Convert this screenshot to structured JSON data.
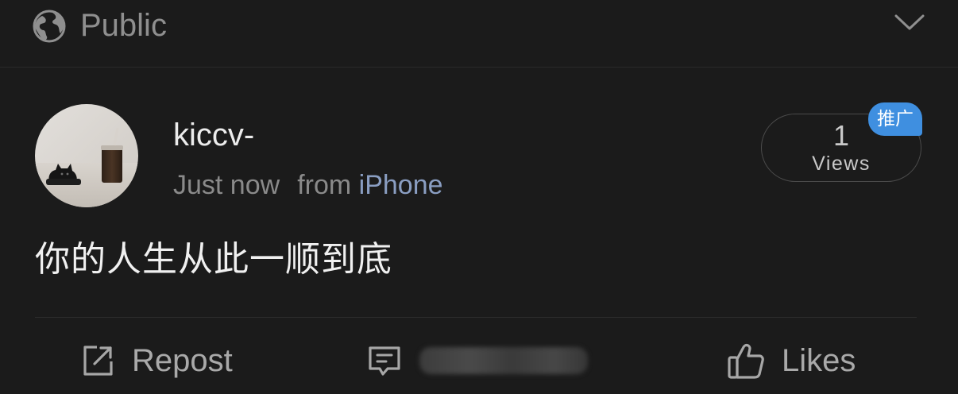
{
  "visibility": {
    "label": "Public",
    "icon": "globe-icon",
    "expand_icon": "chevron-down-icon"
  },
  "post": {
    "username": "kiccv-",
    "time": "Just now",
    "from_prefix": "from",
    "source": "iPhone",
    "text": "你的人生从此一顺到底",
    "views": {
      "count": "1",
      "label": "Views"
    },
    "promo_badge": "推广"
  },
  "actions": {
    "repost": {
      "label": "Repost",
      "icon": "repost-icon"
    },
    "comment": {
      "icon": "comment-icon"
    },
    "likes": {
      "label": "Likes",
      "icon": "thumbs-up-icon"
    }
  },
  "colors": {
    "background": "#1b1b1b",
    "link_blue": "#8a9ec2",
    "badge_blue": "#3f8fe0"
  }
}
